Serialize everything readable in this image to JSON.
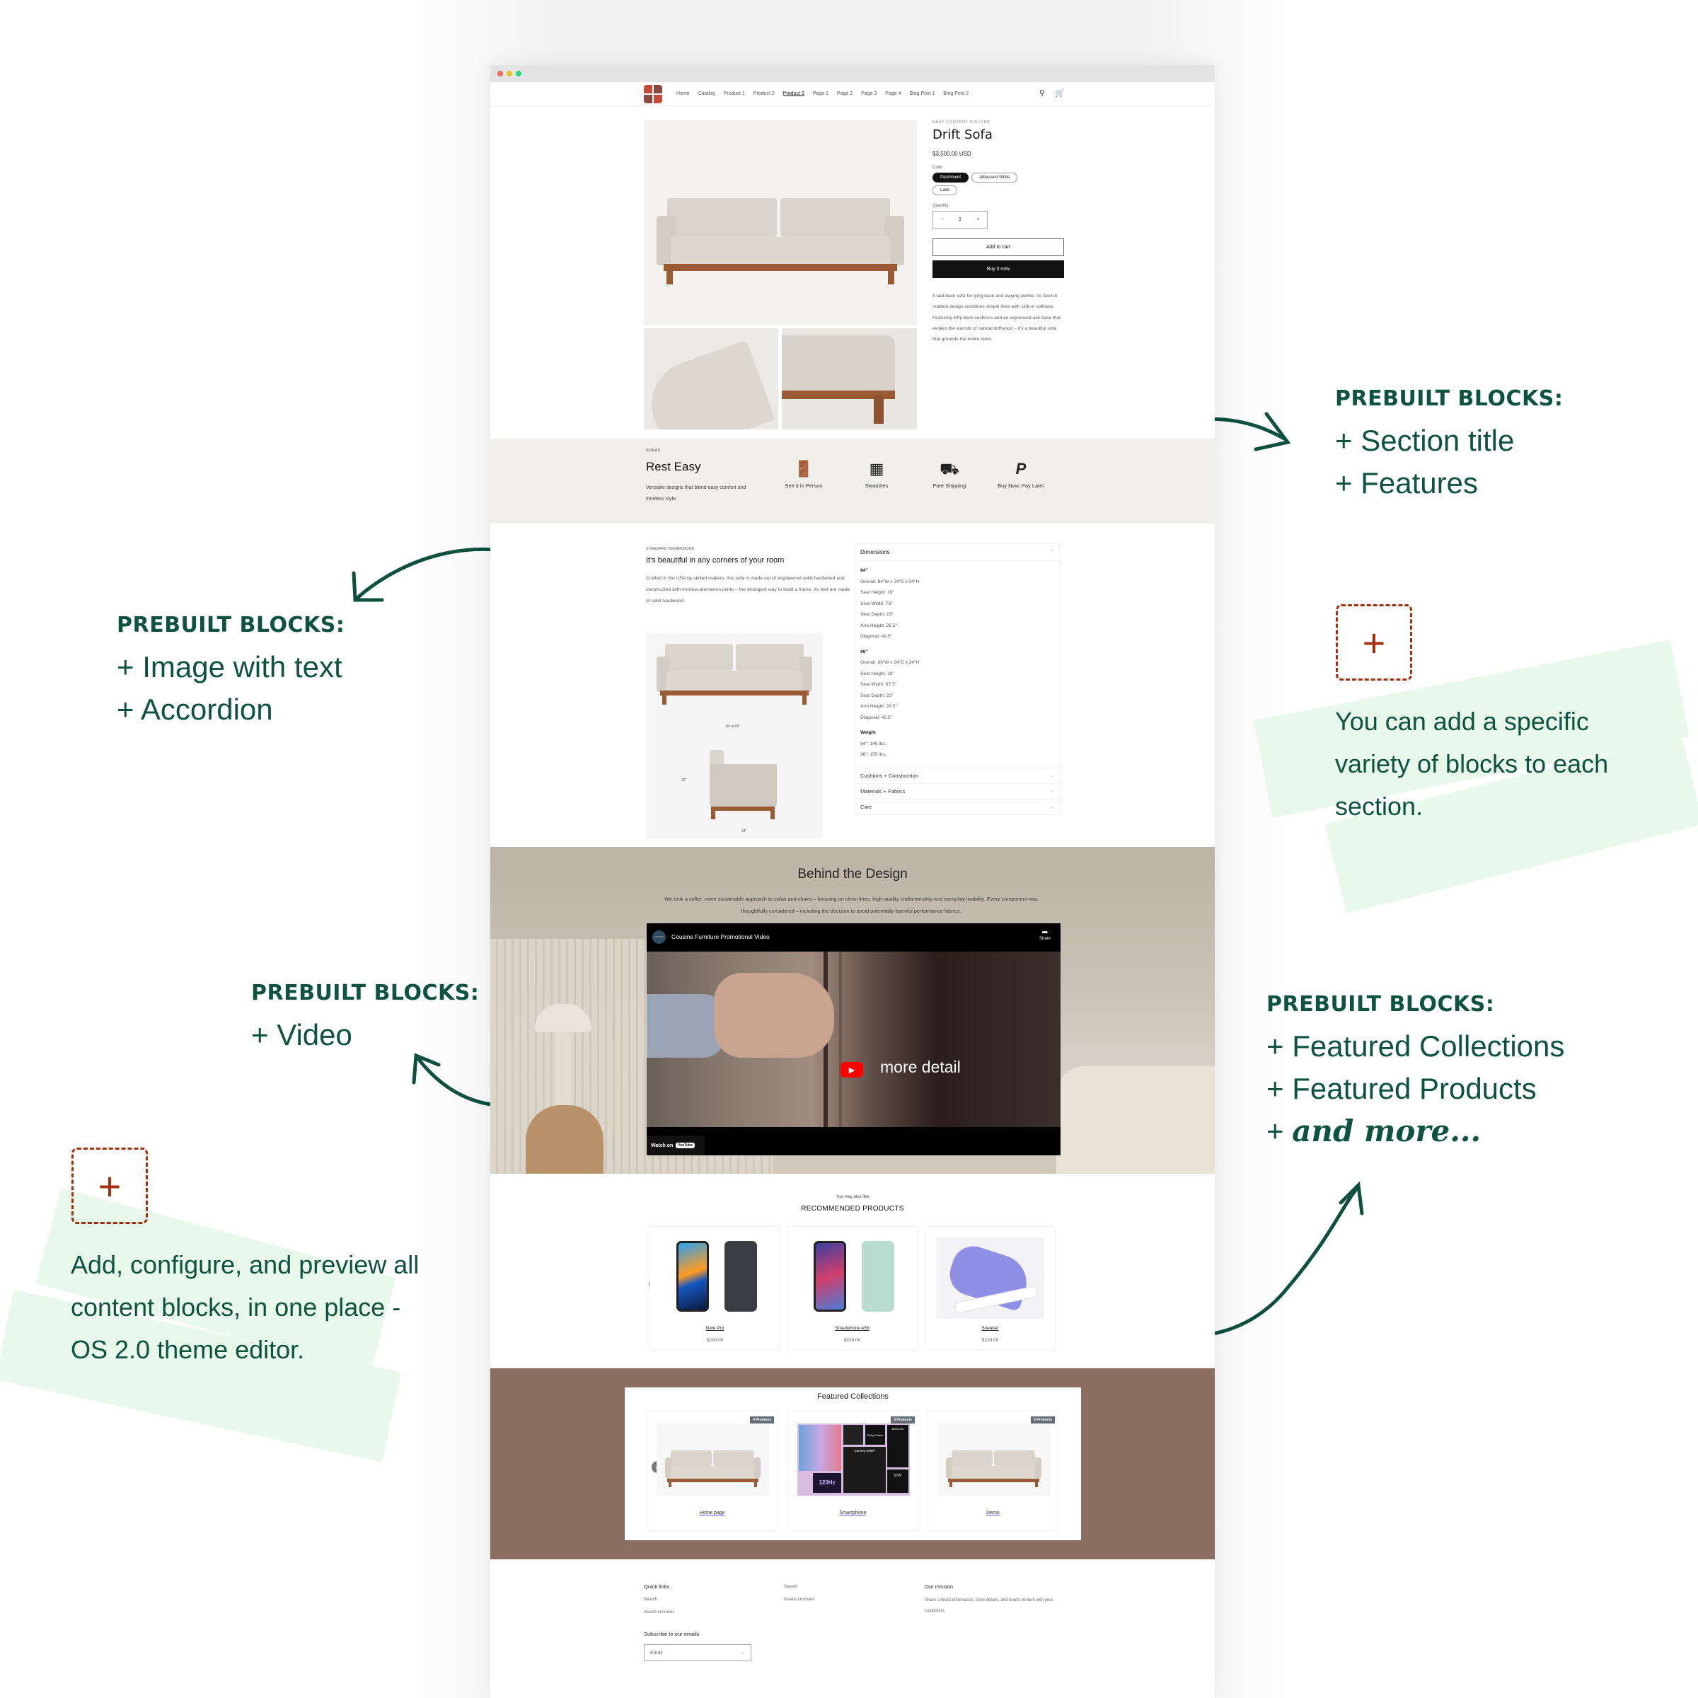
{
  "annotations": {
    "top_right": {
      "heading": "PREBUILT BLOCKS:",
      "items": [
        "+ Section title",
        "+ Features"
      ]
    },
    "mid_left": {
      "heading": "PREBUILT BLOCKS:",
      "items": [
        "+ Image with text",
        "+ Accordion"
      ]
    },
    "mid_right_note": {
      "icon": "plus-icon",
      "text": "You can add a specific variety of blocks to each section."
    },
    "video_left": {
      "heading": "PREBUILT BLOCKS:",
      "items": [
        "+ Video"
      ]
    },
    "bottom_right": {
      "heading": "PREBUILT BLOCKS:",
      "items": [
        "+ Featured Collections",
        "+ Featured Products"
      ],
      "more": "and more..."
    },
    "bottom_left_note": {
      "icon": "plus-icon",
      "text": "Add, configure, and preview all content blocks, in one place - OS 2.0 theme editor."
    }
  },
  "colors": {
    "annotation_green": "#0e5240",
    "plus_red": "#a3300f",
    "swash_green": "#e8f8ea",
    "features_bg": "#f1efe9",
    "collections_bg": "#8c6e61",
    "button_dark": "#121212"
  },
  "nav": {
    "links": [
      "Home",
      "Catalog",
      "Product 1",
      "Product 2",
      "Product 3",
      "Page 1",
      "Page 2",
      "Page 3",
      "Page 4",
      "Blog Post 1",
      "Blog Post 2"
    ],
    "active": "Product 3",
    "icons": [
      "search-icon",
      "cart-icon"
    ]
  },
  "product": {
    "vendor": "EASY CONTENT BUILDER",
    "title": "Drift Sofa",
    "price": "$3,500.00 USD",
    "color_label": "Color",
    "colors": [
      "Parchment",
      "Albescent White",
      "Lace"
    ],
    "selected_color": "Parchment",
    "quantity_label": "Quantity",
    "quantity": "1",
    "minus": "−",
    "plus": "+",
    "add_to_cart": "Add to cart",
    "buy_now": "Buy it now",
    "description": "A laid-back sofa for lying back and staying awhile. Its Danish modern design combines simple lines with sink-in softness. Featuring lofty back cushions and an expressed oak base that evokes the warmth of natural driftwood – it's a beautiful sofa that grounds the entire room."
  },
  "features": {
    "tag": "SOFAS",
    "title": "Rest Easy",
    "subtitle": "Versatile designs that blend easy comfort and timeless style.",
    "items": [
      {
        "label": "See it in Person",
        "icon": "door-icon"
      },
      {
        "label": "Swatches",
        "icon": "swatches-icon"
      },
      {
        "label": "Free Shipping",
        "icon": "truck-icon"
      },
      {
        "label": "Buy Now, Pay Later",
        "icon": "paypal-icon"
      }
    ]
  },
  "dimensions": {
    "tag": "STANDARD DEMENSIONS",
    "title": "It's beautiful in any corners of your room",
    "text": "Crafted in the USA by skilled makers, this sofa is made out of engineered solid hardwood and constructed with mortise-and-tenon joints – the strongest way to build a frame. Its feet are made of solid hardwood.",
    "img_labels": {
      "front_width": "84 or 96\"",
      "side_height": "34\"",
      "side_depth": "34\""
    },
    "accordion": {
      "open_title": "Dimensions",
      "groups": [
        {
          "head": "84\"",
          "lines": [
            "Overall: 84\"W x 34\"D x 34\"H",
            "Seat Height: 19\"",
            "Seat Width: 75\"",
            "Seat Depth: 23\"",
            "Arm Height: 26.5\"",
            "Diagonal: 42.5\""
          ]
        },
        {
          "head": "96\"",
          "lines": [
            "Overall: 96\"W x 34\"D x 34\"H",
            "Seat Height: 19\"",
            "Seat Width: 87.5\"",
            "Seat Depth: 23\"",
            "Arm Height: 26.5\"",
            "Diagonal: 42.5\""
          ]
        },
        {
          "head": "Weight",
          "lines": [
            "84\": 145 lbs.",
            "96\": 155 lbs."
          ]
        }
      ],
      "closed": [
        "Cushions + Construction",
        "Materials + Fabrics",
        "Care"
      ]
    }
  },
  "video": {
    "title": "Behind the Design",
    "subtitle": "We took a softer, more sustainable approach to sofas and chairs – focusing on clean lines, high-quality craftsmanship and everyday livability. Every component was thoughtfully considered – including the decision to avoid potentially-harmful performance fabrics.",
    "player_title": "Cousins Furniture Promotional Video",
    "channel": "COUSINS",
    "share": "Share",
    "overlay_text": "more detail",
    "watch_on": "Watch on",
    "youtube": "YouTube"
  },
  "recommended": {
    "small": "You may also like",
    "title": "RECOMMENDED PRODUCTS",
    "products": [
      {
        "name": "Note Pro",
        "price": "$200.00"
      },
      {
        "name": "Smartphone A55",
        "price": "$220.00"
      },
      {
        "name": "Sneaker",
        "price": "$120.00"
      }
    ]
  },
  "collections": {
    "title": "Featured Collections",
    "items": [
      {
        "name": "Home page",
        "badge": "4 Products"
      },
      {
        "name": "Smartphone",
        "badge": "3 Products"
      },
      {
        "name": "Demo",
        "badge": "6 Products"
      }
    ],
    "promo_labels": [
      "AMOLED",
      "Dolby Vision",
      "Camera 50MP",
      "120Hz",
      "67W"
    ]
  },
  "footer": {
    "quick_links_title": "Quick links",
    "quick_links": [
      "Search",
      "Assets Licenses"
    ],
    "col2_links": [
      "Search",
      "Assets Licenses"
    ],
    "mission_title": "Our mission",
    "mission_text": "Share contact information, store details, and brand content with your customers.",
    "subscribe_title": "Subscribe to our emails",
    "email_placeholder": "Email",
    "submit_arrow": "→"
  }
}
